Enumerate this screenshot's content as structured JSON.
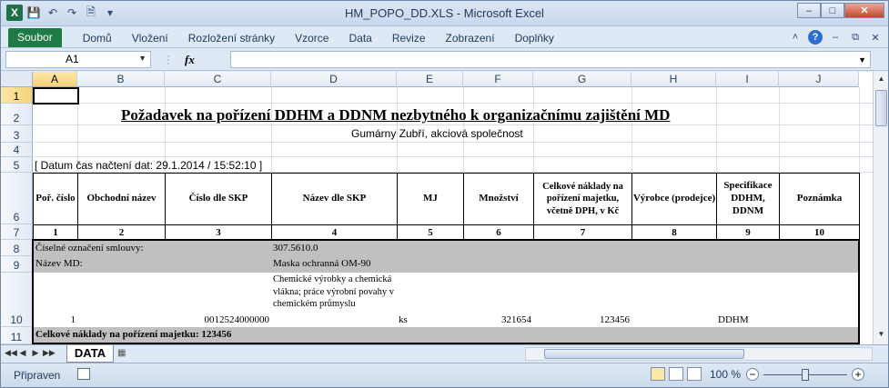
{
  "window": {
    "title": "HM_POPO_DD.XLS - Microsoft Excel"
  },
  "qat": {
    "app_icon": "X",
    "save_icon": "save-icon",
    "undo_icon": "undo-icon",
    "redo_icon": "redo-icon"
  },
  "ribbon": {
    "file_tab": "Soubor",
    "tabs": [
      "Domů",
      "Vložení",
      "Rozložení stránky",
      "Vzorce",
      "Data",
      "Revize",
      "Zobrazení",
      "Doplňky"
    ]
  },
  "formula": {
    "namebox": "A1",
    "fx": "fx",
    "value": ""
  },
  "columns": [
    "A",
    "B",
    "C",
    "D",
    "E",
    "F",
    "G",
    "H",
    "I",
    "J"
  ],
  "rows": [
    "1",
    "2",
    "3",
    "4",
    "5",
    "6",
    "7",
    "8",
    "9",
    "10",
    "11"
  ],
  "sheet": {
    "title": "Požadavek na pořízení DDHM a DDNM nezbytného k organizačnímu zajištění MD",
    "company": "Gumárny Zubří, akciová společnost",
    "timestamp": "[ Datum čas načtení dat: 29.1.2014 / 15:52:10 ]",
    "headers": [
      "Poř. číslo",
      "Obchodní název",
      "Číslo dle SKP",
      "Název dle SKP",
      "MJ",
      "Množství",
      "Celkové náklady na pořízení majetku, včetně DPH, v Kč",
      "Výrobce (prodejce)",
      "Specifikace DDHM, DDNM",
      "Poznámka"
    ],
    "numbers": [
      "1",
      "2",
      "3",
      "4",
      "5",
      "6",
      "7",
      "8",
      "9",
      "10"
    ],
    "contract_label": "Číselné označení smlouvy:",
    "contract_value": "307.5610.0",
    "md_label": "Název MD:",
    "md_value": "Maska ochranná OM-90",
    "row10": {
      "a": "1",
      "b": "",
      "c": "0012524000000",
      "d": "Chemické výrobky a chemická vlákna; práce výrobní povahy v chemickém průmyslu",
      "e": "ks",
      "f": "321654",
      "g": "123456",
      "h": "",
      "i": "DDHM",
      "j": ""
    },
    "total": "Celkové náklady na pořízení majetku: 123456"
  },
  "sheet_tabs": {
    "active": "DATA"
  },
  "status": {
    "ready": "Připraven",
    "zoom": "100 %"
  }
}
